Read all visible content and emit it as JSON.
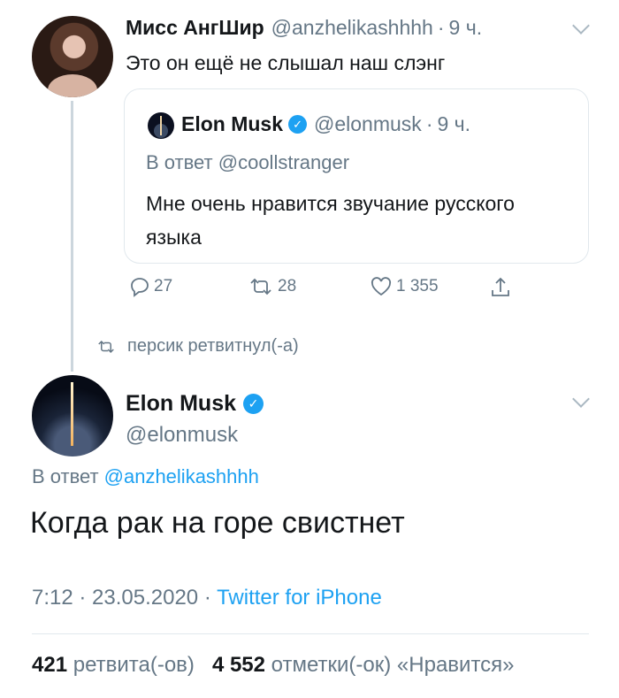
{
  "tweet1": {
    "name": "Мисс АнгШир",
    "handle": "@anzhelikashhhh",
    "time": "9 ч.",
    "text": "Это он ещё не слышал наш слэнг",
    "quote": {
      "name": "Elon Musk",
      "handle": "@elonmusk",
      "time": "9 ч.",
      "reply_to": "В ответ @coollstranger",
      "text": "Мне очень нравится звучание русского языка"
    },
    "actions": {
      "replies": "27",
      "retweets": "28",
      "likes": "1 355"
    }
  },
  "retweet_banner": "персик ретвитнул(-а)",
  "tweet2": {
    "name": "Elon Musk",
    "handle": "@elonmusk",
    "reply_prefix": "В ответ",
    "reply_to": "@anzhelikashhhh",
    "text": "Когда рак на горе свистнет",
    "timestamp": "7:12 · 23.05.2020 ·",
    "source": "Twitter for iPhone",
    "retweets_count": "421",
    "retweets_label": "ретвита(-ов)",
    "likes_count": "4 552",
    "likes_label": "отметки(-ок) «Нравится»"
  },
  "colors": {
    "accent": "#1da1f2",
    "secondary_text": "#657786",
    "primary_text": "#14171a",
    "border": "#e1e8ed"
  }
}
